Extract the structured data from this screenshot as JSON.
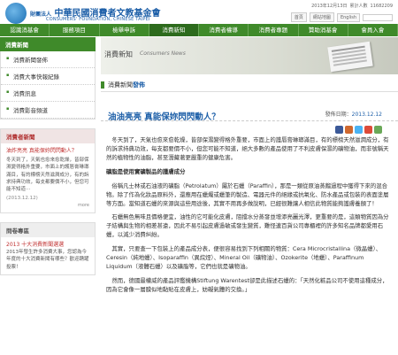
{
  "header": {
    "org_short": "財團法人",
    "org_name": "中華民國消費者文教基金會",
    "org_en": "CONSUMERS' FOUNDATION, CHINESE TAIPEI",
    "date_text": "2013年12月13日",
    "visitors_label": "累計人數",
    "visitors": "11682209",
    "links": [
      "首頁",
      "網站地圖",
      "English"
    ]
  },
  "nav": {
    "items": [
      "認識消基會",
      "服務項目",
      "檢舉申訴",
      "消費新知",
      "消費者權導",
      "消費者專題",
      "贊助消基會",
      "會員入會"
    ],
    "active_index": 3
  },
  "sidebar": {
    "title": "消費新聞",
    "items": [
      "消費新聞發佈",
      "消費大事快報紀錄",
      "消費訊息",
      "消費影音頻道"
    ],
    "box1": {
      "head": "消費者新聞",
      "title": "油炸亮亮 真能保妳閃閃動人？",
      "text": "冬天到了，天氣也愈來愈乾燥，皆部保濕變得格外重要，市面上的護唇膏琳瑯滿目，有的標榜天然滋潤成分，有的訴求持典功效，每支都要價不小，但您可能不知道⋯",
      "date": "(2013.12.12)",
      "more": "more"
    },
    "box2": {
      "head": "問卷專區",
      "link": "2013 十大消費新聞選選",
      "text": "2013年發生許多消費大事，您認為今年度的十大消費新聞有哪些？歡迎踴躍投票！"
    }
  },
  "banner": {
    "zh": "消費新知",
    "en": "Consumers News"
  },
  "breadcrumb": {
    "prefix": "消費新聞",
    "current": "發佈"
  },
  "article": {
    "title": "油油亮亮 真能保妳閃閃動人？",
    "pub_label": "發佈日期：",
    "pub_date": "2013.12.12",
    "paragraphs": [
      "冬天到了，天氣也愈來愈乾燥，皆部保濕變得格外重要，市面上的護唇膏琳瑯滿目，有的標榜天然滋潤成分，有的訴求持典功效，每支都要價不小，但您可能不知道，絕大多數的產品使用了不利皮膚保濕的礦物油，而非號稱天然的植物性的油脂，甚至潛藏著更嚴重的健康危害。",
      "礦脂是使用實礦製品的護膚成分",
      "俗稱凡士林或石油液的礦脂（Petrolatum）屬於石蠟（Paraffin），那是一類從原油蒸餾過程中獲得下來的混合物。除了作為化妝品原料外，還應用在蠟燭或蠟筆的製造、電器元件的絕緣或抗氧化、防水產品或包裝的表面塗層等方面。當知道石蠟的來源與這些用途後，其實不用再多做說明，已經很難讓人相信此物質能夠護膚養顏了！",
      "石蠟無色無味且價格便宜，油性的它可能化皮膚，阻擋水分蒸發並增添亮麗光澤，更重要的是，這類物質因為分子結構與生物的相差甚遠，因此不易引起皮膚過敏或發生變質，難怪連百貨公司專櫃裡的許多知名品牌都愛用石蠟，以減少消費糾紛。",
      "其實，只要查一下包裝上的產品成分表，便很容易找到下列相關的物質：Cera Microcristallina（微晶蠟）、Ceresin（純地蠟）、Isoparaffin（異烷烴）、Mineral Oil（礦物油）、Ozokerite（地蠟）、Paraffinum Liquidum（液體石蠟）以及礦脂等，它們也就是礦物油。",
      "然而，德國最權威的產品評鑑機構Stiftung Warentest卻是此描述石蠟的：「天然化粧品公司不使用這種成分，因為它會像一層膜似地黏貼在皮膚上，妨礙氣體的交換。」"
    ]
  },
  "colors": {
    "nav_green": "#3f8a2a",
    "brand_blue": "#1d5fa8",
    "accent_red": "#c03030"
  },
  "share_icons": [
    "facebook-icon",
    "plurk-icon",
    "twitter-icon",
    "google-icon",
    "share-icon"
  ]
}
